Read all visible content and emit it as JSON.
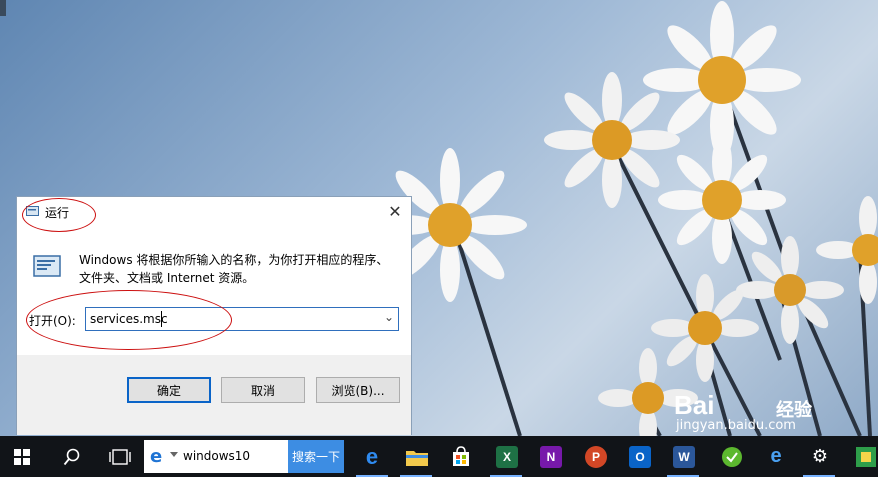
{
  "dialog": {
    "title": "运行",
    "close_glyph": "✕",
    "description_line1": "Windows 将根据你所输入的名称，为你打开相应的程序、",
    "description_line2": "文件夹、文档或 Internet 资源。",
    "open_label": "打开(O):",
    "open_value": "services.msc",
    "dropdown_glyph": "⌄",
    "buttons": {
      "ok": "确定",
      "cancel": "取消",
      "browse": "浏览(B)..."
    }
  },
  "taskbar": {
    "search_text": "windows10",
    "search_button": "搜索一下",
    "apps": [
      {
        "name": "edge",
        "label": "e",
        "color": "#1f74d4"
      },
      {
        "name": "file-explorer",
        "label": "",
        "color": "#f2c94c"
      },
      {
        "name": "store",
        "label": "",
        "color": "#ffffff"
      },
      {
        "name": "excel",
        "label": "X",
        "color": "#1e7145"
      },
      {
        "name": "onenote",
        "label": "N",
        "color": "#7719aa"
      },
      {
        "name": "powerpoint",
        "label": "P",
        "color": "#d24726"
      },
      {
        "name": "outlook",
        "label": "O",
        "color": "#0a64c8"
      },
      {
        "name": "word",
        "label": "W",
        "color": "#2b579a"
      }
    ]
  },
  "watermark": {
    "brand": "Bai",
    "brand_suffix": "经验",
    "url": "jingyan.baidu.com"
  }
}
